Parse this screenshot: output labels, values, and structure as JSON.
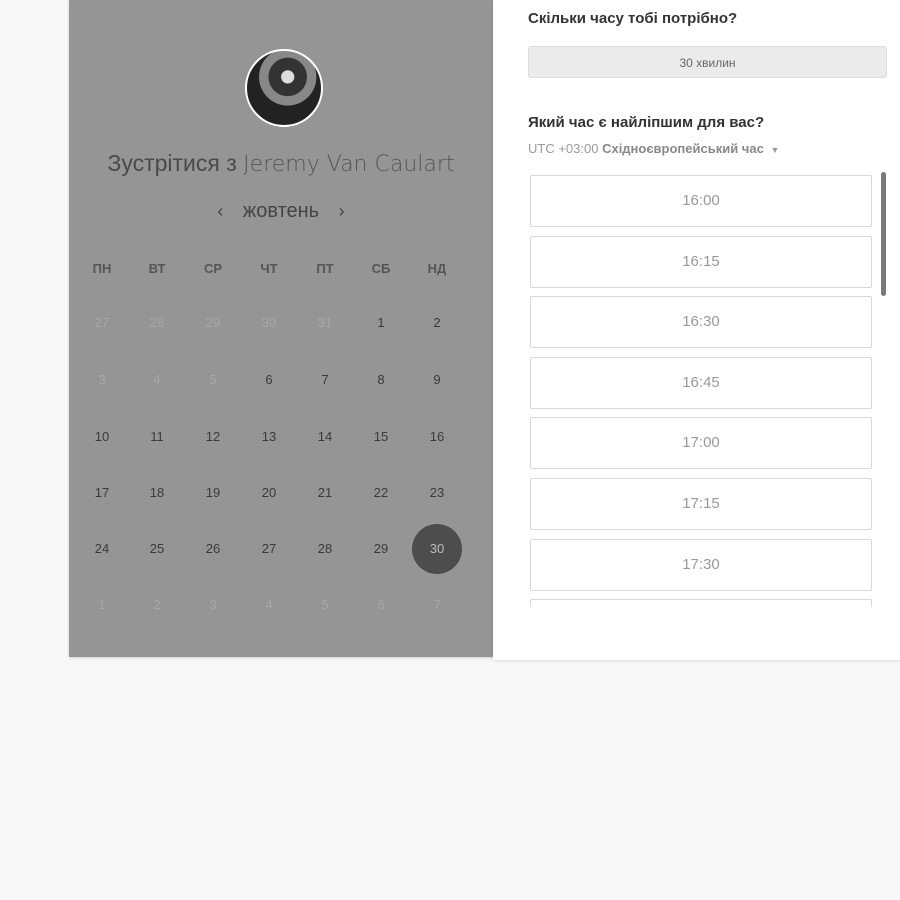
{
  "host": {
    "title_prefix": "Зустрітися з",
    "name": "Jeremy Van Caulart"
  },
  "calendar": {
    "month": "жовтень",
    "prev_label": "‹",
    "next_label": "›",
    "weekdays": [
      "ПН",
      "ВТ",
      "СР",
      "ЧТ",
      "ПТ",
      "СБ",
      "НД"
    ],
    "weeks": [
      [
        "27",
        "28",
        "29",
        "30",
        "31",
        "1",
        "2"
      ],
      [
        "3",
        "4",
        "5",
        "6",
        "7",
        "8",
        "9"
      ],
      [
        "10",
        "11",
        "12",
        "13",
        "14",
        "15",
        "16"
      ],
      [
        "17",
        "18",
        "19",
        "20",
        "21",
        "22",
        "23"
      ],
      [
        "24",
        "25",
        "26",
        "27",
        "28",
        "29",
        "30"
      ],
      [
        "1",
        "2",
        "3",
        "4",
        "5",
        "6",
        "7"
      ]
    ],
    "muted": [
      [
        0,
        0
      ],
      [
        0,
        1
      ],
      [
        0,
        2
      ],
      [
        0,
        3
      ],
      [
        0,
        4
      ],
      [
        1,
        0
      ],
      [
        1,
        1
      ],
      [
        1,
        2
      ],
      [
        5,
        0
      ],
      [
        5,
        1
      ],
      [
        5,
        2
      ],
      [
        5,
        3
      ],
      [
        5,
        4
      ],
      [
        5,
        5
      ],
      [
        5,
        6
      ]
    ],
    "selected": [
      4,
      6
    ]
  },
  "duration": {
    "heading": "Скільки часу тобі потрібно?",
    "value": "30 хвилин"
  },
  "time": {
    "heading": "Який час є найліпшим для вас?",
    "tz_offset": "UTC +03:00",
    "tz_name": "Східноєвропейський час",
    "slots": [
      "16:00",
      "16:15",
      "16:30",
      "16:45",
      "17:00",
      "17:15",
      "17:30",
      ""
    ]
  }
}
